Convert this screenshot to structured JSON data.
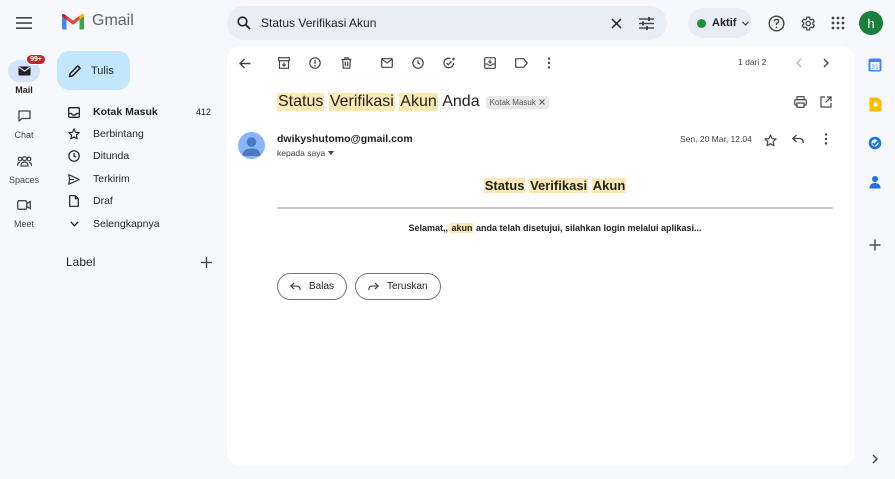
{
  "app": {
    "name": "Gmail"
  },
  "search": {
    "query": "Status Verifikasi Akun"
  },
  "status": {
    "label": "Aktif",
    "color": "#1e8e3e"
  },
  "account": {
    "initial": "h",
    "color": "#1b7f3c"
  },
  "rail": {
    "mail": {
      "label": "Mail",
      "badge": "99+"
    },
    "chat": {
      "label": "Chat"
    },
    "spaces": {
      "label": "Spaces"
    },
    "meet": {
      "label": "Meet"
    }
  },
  "compose": {
    "label": "Tulis"
  },
  "nav": {
    "inbox": {
      "label": "Kotak Masuk",
      "count": "412"
    },
    "starred": {
      "label": "Berbintang"
    },
    "snoozed": {
      "label": "Ditunda"
    },
    "sent": {
      "label": "Terkirim"
    },
    "drafts": {
      "label": "Draf"
    },
    "more": {
      "label": "Selengkapnya"
    }
  },
  "labels": {
    "title": "Label"
  },
  "toolbar": {
    "pager": "1 dari 2"
  },
  "email": {
    "subject_words": [
      "Status",
      "Verifikasi",
      "Akun",
      "Anda"
    ],
    "tag": "Kotak Masuk",
    "sender": "dwikyshutomo@gmail.com",
    "to": "kepada saya",
    "date": "Sen, 20 Mar, 12.04",
    "body_title_words": [
      "Status",
      "Verifikasi",
      "Akun"
    ],
    "body_text": {
      "before": "Selamat,, ",
      "highlight": "akun",
      "after": " anda telah disetujui, silahkan login melalui aplikasi..."
    }
  },
  "actions": {
    "reply": "Balas",
    "forward": "Teruskan"
  },
  "colors": {
    "accent": "#0b57d0",
    "highlight": "#fce8b2",
    "compose": "#c2e7ff",
    "badge": "#c5221f"
  }
}
